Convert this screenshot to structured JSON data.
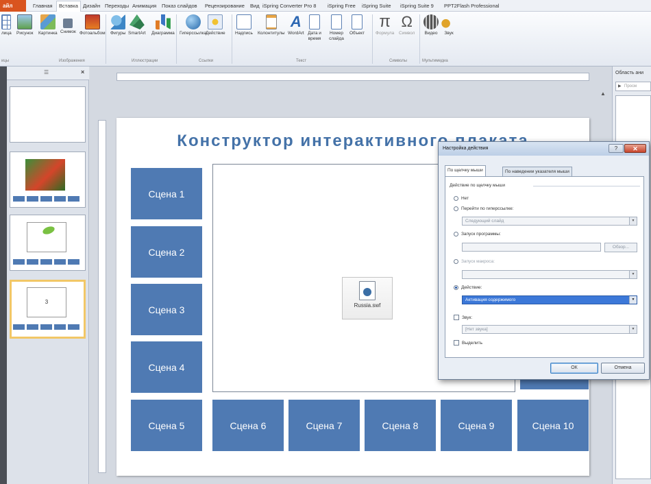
{
  "menu": {
    "file": "айл",
    "tabs": [
      "Главная",
      "Вставка",
      "Дизайн",
      "Переходы",
      "Анимация",
      "Показ слайдов",
      "Рецензирование",
      "Вид",
      "iSpring Converter Pro 8",
      "iSpring Free",
      "iSpring Suite",
      "iSpring Suite 9",
      "PPT2Flash Professional"
    ],
    "active_tab": "Вставка"
  },
  "ribbon": {
    "buttons": [
      {
        "label": "лица",
        "icon": "table-icon"
      },
      {
        "label": "Рисунок",
        "icon": "picture-icon"
      },
      {
        "label": "Картинка",
        "icon": "clipart-icon"
      },
      {
        "label": "Снимок",
        "icon": "screenshot-icon"
      },
      {
        "label": "Фотоальбом",
        "icon": "photo-album-icon"
      },
      {
        "label": "Фигуры",
        "icon": "shapes-icon"
      },
      {
        "label": "SmartArt",
        "icon": "smartart-icon"
      },
      {
        "label": "Диаграмма",
        "icon": "chart-icon"
      },
      {
        "label": "Гиперссылка",
        "icon": "hyperlink-icon"
      },
      {
        "label": "Действие",
        "icon": "action-icon"
      },
      {
        "label": "Надпись",
        "icon": "textbox-icon"
      },
      {
        "label": "Колонтитулы",
        "icon": "header-footer-icon"
      },
      {
        "label": "WordArt",
        "icon": "wordart-icon"
      },
      {
        "label": "Дата и время",
        "icon": "datetime-icon"
      },
      {
        "label": "Номер слайда",
        "icon": "slide-number-icon"
      },
      {
        "label": "Объект",
        "icon": "object-icon"
      },
      {
        "label": "Формула",
        "icon": "formula-icon"
      },
      {
        "label": "Символ",
        "icon": "symbol-icon"
      },
      {
        "label": "Видео",
        "icon": "video-icon"
      },
      {
        "label": "Звук",
        "icon": "audio-icon"
      }
    ],
    "groups": [
      "ицы",
      "Изображения",
      "Иллюстрации",
      "Ссылки",
      "Текст",
      "Символы",
      "Мультимедиа"
    ]
  },
  "right_pane": {
    "title": "Область ани",
    "play_button": "Просм"
  },
  "thumbnail_3_text": "3",
  "slide": {
    "title": "Конструктор интерактивного плаката",
    "scenes": [
      "Сцена 1",
      "Сцена 2",
      "Сцена 3",
      "Сцена 4",
      "Сцена 5",
      "Сцена 6",
      "Сцена 7",
      "Сцена 8",
      "Сцена 9",
      "Сцена 10"
    ],
    "embedded_file": "Russia.swf"
  },
  "dialog": {
    "title": "Настройка действия",
    "tabs": [
      "По щелчку мыши",
      "По наведении указателя мыши"
    ],
    "group_label": "Действие по щелчку мыши",
    "options": {
      "none": "Нет",
      "hyperlink": "Перейти по гиперссылке:",
      "hyperlink_value": "Следующий слайд",
      "run_program": "Запуск программы:",
      "browse": "Обзор...",
      "run_macro": "Запуск макроса:",
      "action": "Действие:",
      "action_value": "Активация содержимого",
      "sound": "Звук:",
      "sound_value": "[Нет звука]",
      "highlight": "Выделить"
    },
    "ok": "ОК",
    "cancel": "Отмена"
  },
  "colors": {
    "scene_fill": "#4f7ab3",
    "title": "#4472a8",
    "file_tab": "#d9541f",
    "selection": "#3c78d8"
  }
}
